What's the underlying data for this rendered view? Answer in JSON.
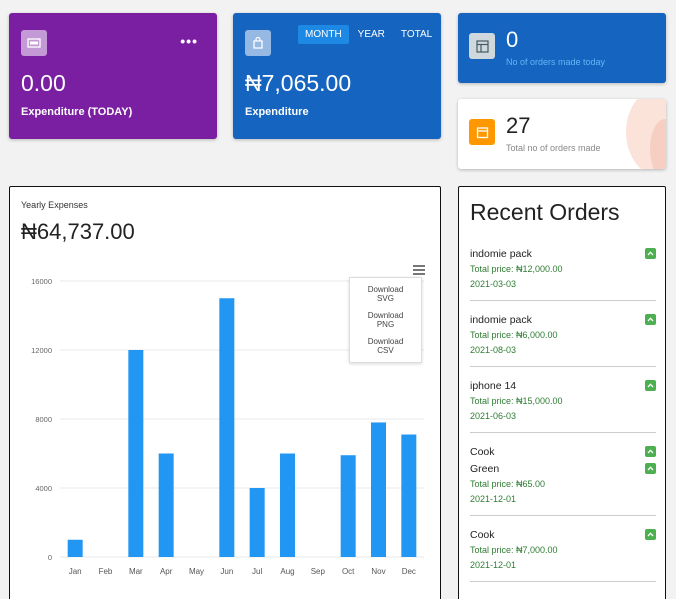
{
  "expenditure_today": {
    "value": "0.00",
    "label": "Expenditure (TODAY)",
    "menu_icon": "dots-icon",
    "icon": "cash-icon"
  },
  "expenditure_period": {
    "value": "₦7,065.00",
    "label": "Expenditure",
    "tabs": [
      {
        "label": "MONTH",
        "active": true
      },
      {
        "label": "YEAR"
      },
      {
        "label": "TOTAL"
      }
    ],
    "icon": "bag-icon"
  },
  "orders_today": {
    "count": "0",
    "label": "No of orders made today",
    "icon": "table-icon"
  },
  "orders_total": {
    "count": "27",
    "label": "Total no of orders made",
    "icon": "store-icon"
  },
  "yearly": {
    "subtitle": "Yearly Expenses",
    "total": "₦64,737.00",
    "download_menu": [
      "Download SVG",
      "Download PNG",
      "Download CSV"
    ]
  },
  "chart_data": {
    "type": "bar",
    "title": "",
    "xlabel": "",
    "ylabel": "",
    "categories": [
      "Jan",
      "Feb",
      "Mar",
      "Apr",
      "May",
      "Jun",
      "Jul",
      "Aug",
      "Sep",
      "Oct",
      "Nov",
      "Dec"
    ],
    "values": [
      1000,
      0,
      12000,
      6000,
      0,
      15000,
      4000,
      6000,
      0,
      5900,
      7800,
      7100
    ],
    "yticks": [
      "0",
      "4000",
      "8000",
      "12000",
      "16000"
    ],
    "ylim": [
      0,
      16000
    ],
    "color": "#2196f3",
    "grid": true
  },
  "recent_orders": {
    "title": "Recent Orders",
    "orders": [
      {
        "items": [
          "indomie pack"
        ],
        "price": "Total price: ₦12,000.00",
        "date": "2021-03-03"
      },
      {
        "items": [
          "indomie pack"
        ],
        "price": "Total price: ₦6,000.00",
        "date": "2021-08-03"
      },
      {
        "items": [
          "iphone 14"
        ],
        "price": "Total price: ₦15,000.00",
        "date": "2021-06-03"
      },
      {
        "items": [
          "Cook",
          "Green"
        ],
        "price": "Total price: ₦65.00",
        "date": "2021-12-01"
      },
      {
        "items": [
          "Cook"
        ],
        "price": "Total price: ₦7,000.00",
        "date": "2021-12-01"
      }
    ]
  }
}
